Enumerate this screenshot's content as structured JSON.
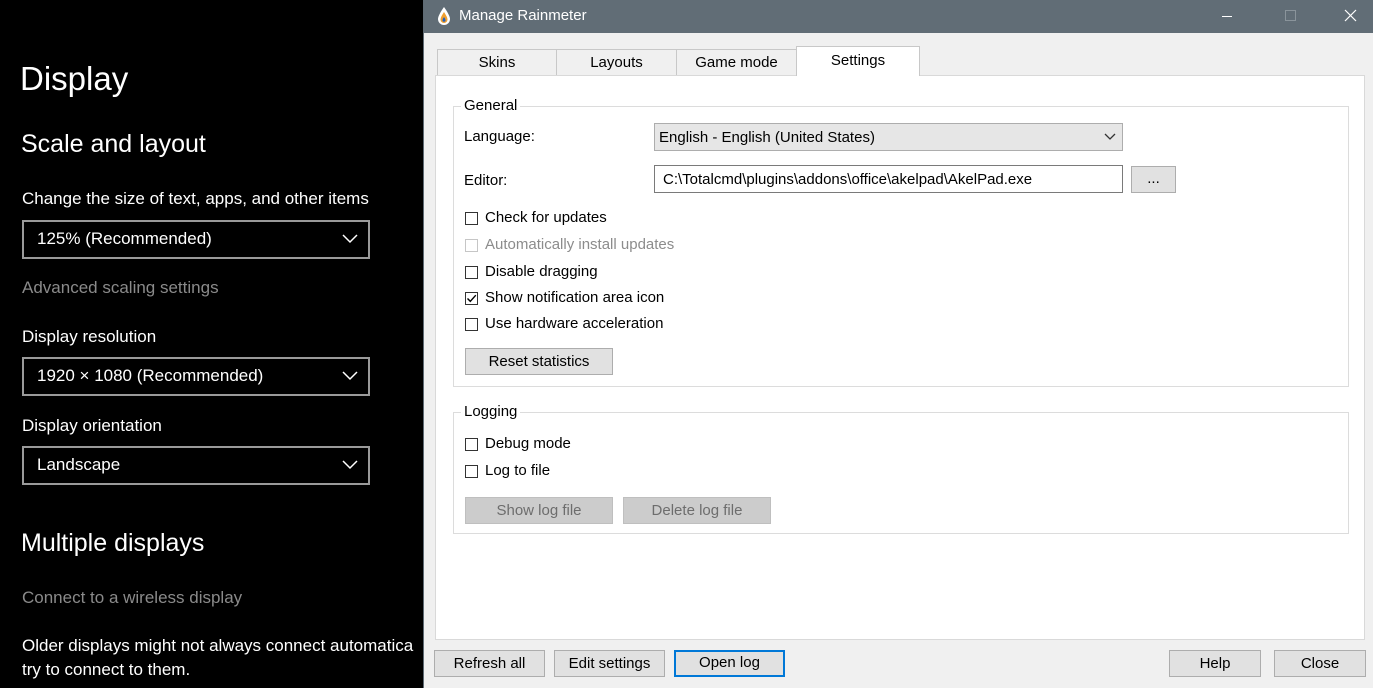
{
  "settings": {
    "title": "Display",
    "scale_section": "Scale and layout",
    "size_label": "Change the size of text, apps, and other items",
    "size_value": "125% (Recommended)",
    "advanced_link": "Advanced scaling settings",
    "resolution_label": "Display resolution",
    "resolution_value": "1920 × 1080 (Recommended)",
    "orientation_label": "Display orientation",
    "orientation_value": "Landscape",
    "multiple_section": "Multiple displays",
    "wireless_link": "Connect to a wireless display",
    "paragraph_line1": "Older displays might not always connect automatica",
    "paragraph_line2": "try to connect to them."
  },
  "window": {
    "title": "Manage Rainmeter",
    "tabs": [
      {
        "label": "Skins"
      },
      {
        "label": "Layouts"
      },
      {
        "label": "Game mode"
      },
      {
        "label": "Settings"
      }
    ],
    "active_tab": "Settings"
  },
  "general": {
    "legend": "General",
    "language_label": "Language:",
    "language_value": "English - English (United States)",
    "editor_label": "Editor:",
    "editor_value": "C:\\Totalcmd\\plugins\\addons\\office\\akelpad\\AkelPad.exe",
    "browse_label": "...",
    "checkboxes": [
      {
        "label": "Check for updates",
        "checked": false,
        "enabled": true
      },
      {
        "label": "Automatically install updates",
        "checked": false,
        "enabled": false
      },
      {
        "label": "Disable dragging",
        "checked": false,
        "enabled": true
      },
      {
        "label": "Show notification area icon",
        "checked": true,
        "enabled": true
      },
      {
        "label": "Use hardware acceleration",
        "checked": false,
        "enabled": true
      }
    ],
    "reset_label": "Reset statistics"
  },
  "logging": {
    "legend": "Logging",
    "checkboxes": [
      {
        "label": "Debug mode",
        "checked": false,
        "enabled": true
      },
      {
        "label": "Log to file",
        "checked": false,
        "enabled": true
      }
    ],
    "show_log_label": "Show log file",
    "delete_log_label": "Delete log file"
  },
  "footer": {
    "refresh_label": "Refresh all",
    "edit_label": "Edit settings",
    "open_log_label": "Open log",
    "help_label": "Help",
    "close_label": "Close"
  },
  "colors": {
    "titlebar": "#616d76",
    "focus_border": "#0078d7",
    "settings_bg": "#000000"
  }
}
